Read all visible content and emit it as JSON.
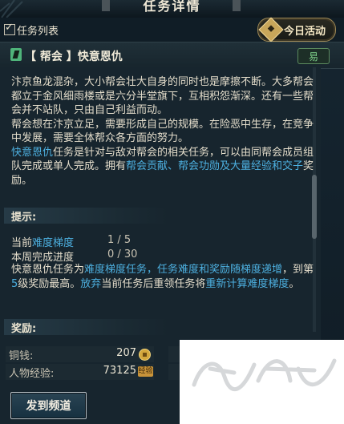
{
  "window": {
    "title": "任务详情"
  },
  "toolbar": {
    "list_label": "任务列表",
    "daily_label": "今日活动"
  },
  "quest": {
    "name": "【 帮会 】快意恩仇",
    "difficulty_badge": "易"
  },
  "description": {
    "p1": "汴京鱼龙混杂，大小帮会壮大自身的同时也是摩擦不断。大多帮会都立于金风细雨楼或是六分半堂旗下，互相积怨渐深。还有一些帮会并不站队，只由自己利益而动。",
    "p2": "帮会想在汴京立足，需要形成自己的规模。在险恶中生存，在竞争中发展，需要全体帮众各方面的努力。",
    "p3_hl1": "快意恩仇",
    "p3_t1": "任务是针对与敌对帮会的相关任务，可以由同帮会成员组队完成或单人完成。拥有",
    "p3_hl2": "帮会贡献、帮会功勋及大量经验和交子",
    "p3_t2": "奖励。"
  },
  "tips": {
    "header": "提示:",
    "level_label_a": "当前",
    "level_label_hl": "难度梯度",
    "level_value": "1 / 5",
    "week_label": "本周完成进度",
    "week_value": "0 / 30",
    "note_t1": "快意恩仇任务为",
    "note_hl1": "难度梯度任务，任务难度和奖励随梯度递增",
    "note_t2": "，到第",
    "note_num": "5",
    "note_t3": "级奖励最高。",
    "note_hl2": "放弃",
    "note_t4": "当前任务后重领任务将",
    "note_hl3": "重新计算难度梯度",
    "note_t5": "。"
  },
  "rewards": {
    "header": "奖励:",
    "coin_label": "铜钱:",
    "coin_value": "207",
    "exp_label": "人物经验:",
    "exp_value": "73125",
    "exp_icon_text": "经验"
  },
  "actions": {
    "send_label": "发到频道"
  },
  "icons": {
    "quest": "quest-scroll-icon",
    "coin": "coin-icon",
    "exp": "exp-icon",
    "daily": "diamond-icon"
  },
  "colors": {
    "highlight": "#4db0e0",
    "difficulty_easy": "#7ed08a",
    "background": "#17252e"
  }
}
